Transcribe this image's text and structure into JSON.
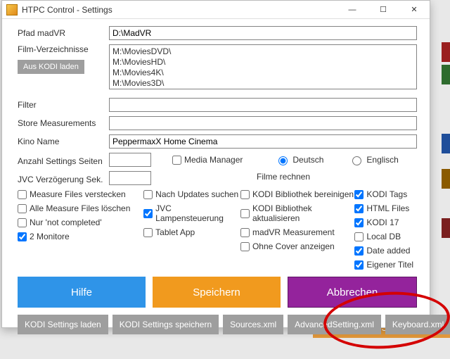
{
  "window": {
    "title": "HTPC Control - Settings"
  },
  "labels": {
    "pfad": "Pfad madVR",
    "filmdirs": "Film-Verzeichnisse",
    "loadkodi": "Aus KODI laden",
    "filter": "Filter",
    "store": "Store Measurements",
    "kino": "Kino Name",
    "pages": "Anzahl Settings Seiten",
    "jvc": "JVC Verzögerung Sek.",
    "mediamgr": "Media Manager",
    "deutsch": "Deutsch",
    "englisch": "Englisch",
    "filme_rechnen": "Filme rechnen"
  },
  "values": {
    "pfad": "D:\\MadVR",
    "dirs": "M:\\MoviesDVD\\\nM:\\MoviesHD\\\nM:\\Movies4K\\\nM:\\Movies3D\\",
    "filter": "",
    "store": "",
    "kino": "PeppermaxX Home Cinema",
    "pages": "",
    "jvc": ""
  },
  "checks_left": [
    {
      "id": "mf_hide",
      "label": "Measure Files verstecken",
      "checked": false
    },
    {
      "id": "mf_del",
      "label": "Alle Measure Files löschen",
      "checked": false
    },
    {
      "id": "not_comp",
      "label": "Nur 'not completed'",
      "checked": false
    },
    {
      "id": "two_mon",
      "label": "2 Monitore",
      "checked": true
    }
  ],
  "checks_mid": [
    {
      "id": "updates",
      "label": "Nach Updates suchen",
      "checked": false
    },
    {
      "id": "jvclamp",
      "label": "JVC Lampensteuerung",
      "checked": true
    },
    {
      "id": "tablet",
      "label": "Tablet App",
      "checked": false
    }
  ],
  "checks_filme": [
    {
      "id": "bib_clean",
      "label": "KODI Bibliothek bereinigen",
      "checked": false
    },
    {
      "id": "bib_upd",
      "label": "KODI Bibliothek aktualisieren",
      "checked": false
    },
    {
      "id": "madvr_m",
      "label": "madVR Measurement",
      "checked": false
    },
    {
      "id": "no_cover",
      "label": "Ohne Cover anzeigen",
      "checked": false
    }
  ],
  "checks_right": [
    {
      "id": "tags",
      "label": "KODI Tags",
      "checked": true
    },
    {
      "id": "html",
      "label": "HTML Files",
      "checked": true
    },
    {
      "id": "k17",
      "label": "KODI 17",
      "checked": true
    },
    {
      "id": "localdb",
      "label": "Local DB",
      "checked": false
    },
    {
      "id": "dateadd",
      "label": "Date added",
      "checked": true
    },
    {
      "id": "eigen",
      "label": "Eigener Titel",
      "checked": true
    }
  ],
  "buttons": {
    "help": "Hilfe",
    "save": "Speichern",
    "cancel": "Abbrechen",
    "kodi_load": "KODI Settings laden",
    "kodi_save": "KODI Settings speichern",
    "sources": "Sources.xml",
    "advset": "AdvancedSetting.xml",
    "keyboard": "Keyboard.xml"
  },
  "lang": "de",
  "bg_colors": [
    "#9a1f1f",
    "#2e6b2e",
    "#1f4e9a",
    "#8a5a00",
    "#235c89",
    "#7a1f1f",
    "#e08a1c"
  ]
}
